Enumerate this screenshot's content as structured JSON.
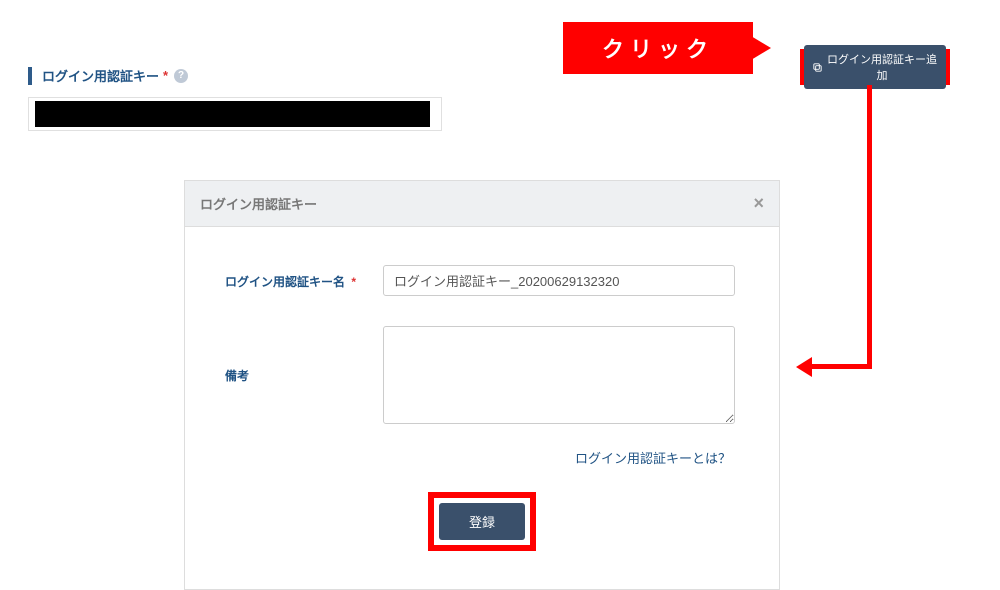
{
  "section": {
    "title": "ログイン用認証キー",
    "required_mark": "*"
  },
  "callout": {
    "click_label": "クリック"
  },
  "add_button": {
    "label": "ログイン用認証キー追加"
  },
  "modal": {
    "title": "ログイン用認証キー",
    "fields": {
      "name_label": "ログイン用認証キー名",
      "name_required": "*",
      "name_value": "ログイン用認証キー_20200629132320",
      "remarks_label": "備考",
      "remarks_value": ""
    },
    "help_link": "ログイン用認証キーとは？",
    "submit_label": "登録"
  }
}
